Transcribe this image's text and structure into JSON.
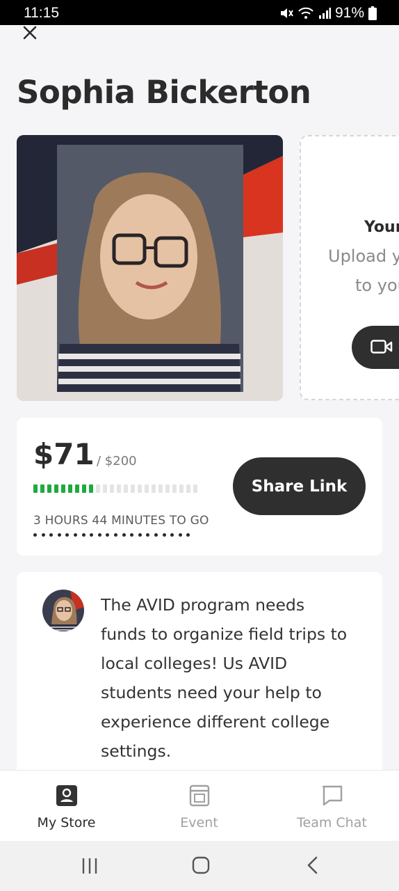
{
  "status_bar": {
    "time": "11:15",
    "battery": "91%"
  },
  "profile": {
    "name": "Sophia Bickerton"
  },
  "video_card": {
    "title": "Your",
    "desc_line1": "Upload y",
    "desc_line2": "to you"
  },
  "fundraiser": {
    "amount_raised": "$71",
    "goal": "/ $200",
    "progress_fraction": 0.355,
    "time_left": "3 HOURS 44 MINUTES TO GO",
    "share_label": "Share Link",
    "accent_color": "#1faa3e"
  },
  "story": {
    "text": "The AVID program needs funds to organize field trips to local colleges! Us AVID students need your help to experience different college settings."
  },
  "tabs": [
    {
      "label": "My Store",
      "icon": "store-person-icon",
      "active": true
    },
    {
      "label": "Event",
      "icon": "event-calendar-icon",
      "active": false
    },
    {
      "label": "Team Chat",
      "icon": "chat-bubble-icon",
      "active": false
    }
  ],
  "system_nav": {
    "buttons": [
      "recents-icon",
      "home-icon",
      "back-icon"
    ]
  }
}
